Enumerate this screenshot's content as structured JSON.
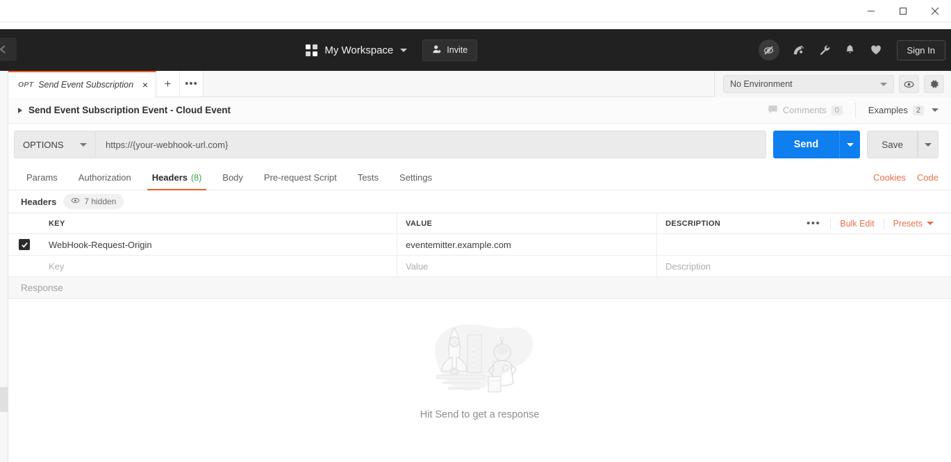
{
  "window": {
    "minimize_label": "minimize",
    "maximize_label": "maximize",
    "close_label": "close"
  },
  "topbar": {
    "workspace_label": "My Workspace",
    "invite_label": "Invite",
    "signin_label": "Sign In",
    "icons": [
      "sync-off-icon",
      "satellite-dish-icon",
      "wrench-icon",
      "bell-icon",
      "heart-icon"
    ]
  },
  "tabstrip": {
    "tab_method": "OPT",
    "tab_title": "Send Event Subscription Event...",
    "close_label": "×",
    "new_tab_label": "+",
    "more_tabs_label": "•••"
  },
  "environment": {
    "selected": "No Environment",
    "eye_icon": "eye-icon",
    "settings_icon": "gear-icon"
  },
  "request": {
    "title": "Send Event Subscription Event - Cloud Event",
    "comments_label": "Comments",
    "comments_count": "0",
    "examples_label": "Examples",
    "examples_count": "2",
    "method": "OPTIONS",
    "url": "https://{your-webhook-url.com}",
    "send_label": "Send",
    "save_label": "Save"
  },
  "request_tabs": {
    "items": [
      {
        "label": "Params",
        "badge": ""
      },
      {
        "label": "Authorization",
        "badge": ""
      },
      {
        "label": "Headers",
        "badge": "(8)"
      },
      {
        "label": "Body",
        "badge": ""
      },
      {
        "label": "Pre-request Script",
        "badge": ""
      },
      {
        "label": "Tests",
        "badge": ""
      },
      {
        "label": "Settings",
        "badge": ""
      }
    ],
    "active_index": 2,
    "cookies_label": "Cookies",
    "code_label": "Code"
  },
  "headers_panel": {
    "section_label": "Headers",
    "hidden_label": "7 hidden",
    "columns": [
      "KEY",
      "VALUE",
      "DESCRIPTION"
    ],
    "bulk_edit_label": "Bulk Edit",
    "presets_label": "Presets",
    "more_label": "•••",
    "rows": [
      {
        "checked": true,
        "key": "WebHook-Request-Origin",
        "value": "eventemitter.example.com",
        "description": ""
      }
    ],
    "placeholder_row": {
      "key": "Key",
      "value": "Value",
      "description": "Description"
    }
  },
  "response": {
    "label": "Response",
    "empty_message": "Hit Send to get a response",
    "illustration": "rocket-launch-astronaut-illustration"
  },
  "colors": {
    "accent_orange": "#ef5b25",
    "link_orange": "#e8704a",
    "send_blue": "#0f7ff0",
    "badge_green": "#3ea24a",
    "topbar_dark": "#212121"
  }
}
